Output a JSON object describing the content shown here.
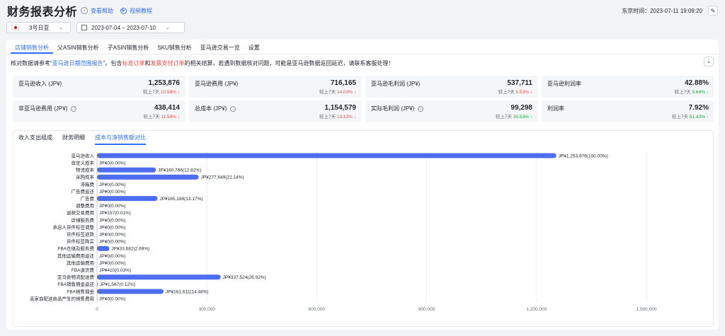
{
  "header": {
    "title": "财务报表分析",
    "help_label": "查看帮助",
    "video_label": "视频教程",
    "time_label": "东京时间：",
    "time_value": "2023-07-11 19:09:20"
  },
  "filters": {
    "shop": "3号日亚",
    "date_range": "2023-07-04 ~ 2023-07-10"
  },
  "tabs": [
    "店铺销售分析",
    "父ASIN销售分析",
    "子ASIN销售分析",
    "SKU销售分析",
    "亚马逊交易一览",
    "设置"
  ],
  "notice": {
    "part1": "核对数据请参考“",
    "link": "亚马逊日期范围报告",
    "part2": "”。包含",
    "red1": "标准订单",
    "part3": "和",
    "red2": "发票支付订单",
    "part4": "的相关结算，若遇到数据核对问题，可能是亚马逊数据返回延迟，请联系客服处理！"
  },
  "metrics": [
    {
      "label": "亚马逊收入 (JP¥)",
      "value": "1,253,876",
      "cmp_label": "较上7天",
      "cmp": "10.58%",
      "dir": "down",
      "info": false
    },
    {
      "label": "亚马逊费用 (JP¥)",
      "value": "716,165",
      "cmp_label": "较上7天",
      "cmp": "14.03%",
      "dir": "down",
      "info": false
    },
    {
      "label": "亚马逊毛利润 (JP¥)",
      "value": "537,711",
      "cmp_label": "较上7天",
      "cmp": "5.53%",
      "dir": "down",
      "info": false
    },
    {
      "label": "亚马逊利润率",
      "value": "42.88%",
      "cmp_label": "较上7天",
      "cmp": "5.64%",
      "dir": "up",
      "info": false
    },
    {
      "label": "非亚马逊费用 (JP¥)",
      "value": "438,414",
      "cmp_label": "较上7天",
      "cmp": "11.59%",
      "dir": "down",
      "info": true
    },
    {
      "label": "总成本 (JP¥)",
      "value": "1,154,579",
      "cmp_label": "较上7天",
      "cmp": "13.12%",
      "dir": "down",
      "info": true
    },
    {
      "label": "实际毛利润 (JP¥)",
      "value": "99,298",
      "cmp_label": "较上7天",
      "cmp": "35.53%",
      "dir": "up",
      "info": true
    },
    {
      "label": "利润率",
      "value": "7.92%",
      "cmp_label": "较上7天",
      "cmp": "51.43%",
      "dir": "up",
      "info": false
    }
  ],
  "subtabs": [
    "收入支出组成",
    "财务明细",
    "成本与净销售额对比"
  ],
  "colors": {
    "accent": "#3370ff",
    "bar": "#4e6ef2",
    "down": "#f54a45",
    "up": "#00b42a"
  },
  "chart_data": {
    "type": "bar",
    "orientation": "horizontal",
    "categories": [
      "亚马逊收入",
      "自定义成本",
      "物流成本",
      "采购成本",
      "滞箱费",
      "广告费返还",
      "广告费",
      "调整费用",
      "退款交易费用",
      "店铺服务费",
      "承运人货件标签调整",
      "货件标签退款",
      "货件标签购买",
      "FBA仓储及服务费",
      "其他运输费用返还",
      "其他运输费用",
      "FBA退货费",
      "亚马逊物流配送费",
      "FBA销售佣金返还",
      "FBA销售佣金",
      "卖家自配送商品产生的销售费用"
    ],
    "values": [
      1253876,
      0,
      160766,
      277649,
      0,
      0,
      165168,
      0,
      157,
      0,
      0,
      0,
      0,
      33682,
      0,
      0,
      410,
      337524,
      1567,
      181611,
      0
    ],
    "data_labels": [
      "JP¥1,253,876(100.00%)",
      "JP¥0(0.00%)",
      "JP¥160,766(12.82%)",
      "JP¥277,649(22.14%)",
      "JP¥0(0.00%)",
      "JP¥0(0.00%)",
      "JP¥165,168(13.17%)",
      "JP¥0(0.00%)",
      "JP¥157(0.01%)",
      "JP¥0(0.00%)",
      "JP¥0(0.00%)",
      "JP¥0(0.00%)",
      "JP¥0(0.00%)",
      "JP¥33,682(2.69%)",
      "JP¥0(0.00%)",
      "JP¥0(0.00%)",
      "JP¥410(0.03%)",
      "JP¥337,524(26.92%)",
      "JP¥1,567(0.12%)",
      "JP¥181,611(14.48%)",
      "JP¥0(0.00%)"
    ],
    "x_ticks": [
      "0",
      "300,000",
      "600,000",
      "900,000",
      "1,200,000",
      "1,500,000"
    ],
    "xlim": [
      0,
      1500000
    ],
    "grid": true
  }
}
